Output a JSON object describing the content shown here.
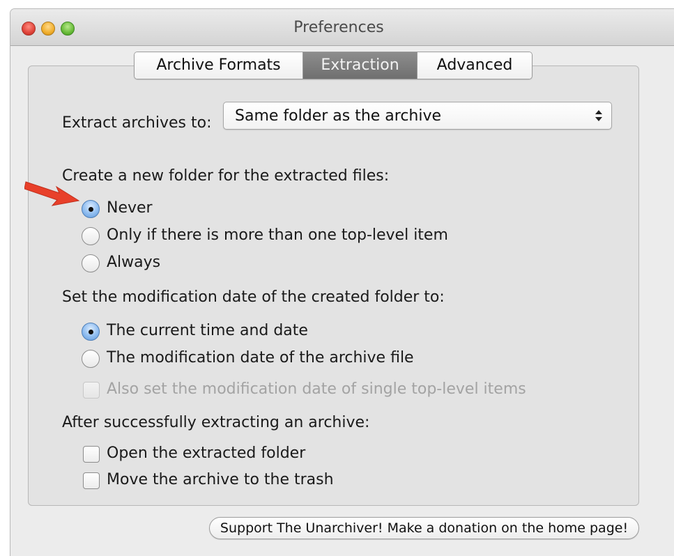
{
  "window": {
    "title": "Preferences"
  },
  "tabs": [
    {
      "label": "Archive Formats",
      "active": false
    },
    {
      "label": "Extraction",
      "active": true
    },
    {
      "label": "Advanced",
      "active": false
    }
  ],
  "extract_to": {
    "label": "Extract archives to:",
    "value": "Same folder as the archive"
  },
  "new_folder": {
    "heading": "Create a new folder for the extracted files:",
    "options": [
      {
        "label": "Never",
        "checked": true
      },
      {
        "label": "Only if there is more than one top-level item",
        "checked": false
      },
      {
        "label": "Always",
        "checked": false
      }
    ]
  },
  "modification_date": {
    "heading": "Set the modification date of the created folder to:",
    "options": [
      {
        "label": "The current time and date",
        "checked": true
      },
      {
        "label": "The modification date of the archive file",
        "checked": false
      }
    ],
    "single_items": {
      "label": "Also set the modification date of single top-level items",
      "checked": false,
      "enabled": false
    }
  },
  "after_extract": {
    "heading": "After successfully extracting an archive:",
    "options": [
      {
        "label": "Open the extracted folder",
        "checked": false
      },
      {
        "label": "Move the archive to the trash",
        "checked": false
      }
    ]
  },
  "donate_button": {
    "label": "Support The Unarchiver! Make a donation on the home page!"
  },
  "colors": {
    "annotation_arrow": "#e8402a",
    "active_tab": "#7a7a7a",
    "radio_selected": "#8fbdf0"
  }
}
